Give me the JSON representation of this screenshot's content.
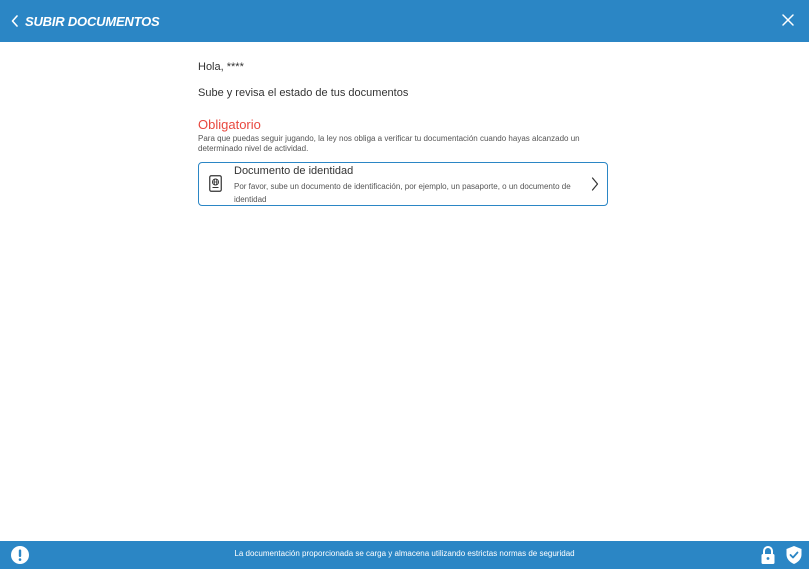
{
  "header": {
    "title": "SUBIR DOCUMENTOS",
    "back_icon": "chevron-left-icon",
    "close_icon": "close-icon"
  },
  "main": {
    "greeting": "Hola, ****",
    "subtitle": "Sube y revisa el estado de tus documentos",
    "section": {
      "title": "Obligatorio",
      "description": "Para que puedas seguir jugando, la ley nos obliga a verificar tu documentación cuando hayas alcanzado un determinado nivel de actividad."
    },
    "document_card": {
      "title": "Documento de identidad",
      "description": "Por favor, sube un documento de identificación, por ejemplo, un pasaporte, o un documento de identidad",
      "icon": "passport-icon"
    }
  },
  "footer": {
    "text": "La documentación proporcionada se carga y almacena utilizando estrictas normas de seguridad"
  },
  "colors": {
    "primary": "#2b86c5",
    "required": "#e8483f",
    "background": "#ffffff"
  }
}
